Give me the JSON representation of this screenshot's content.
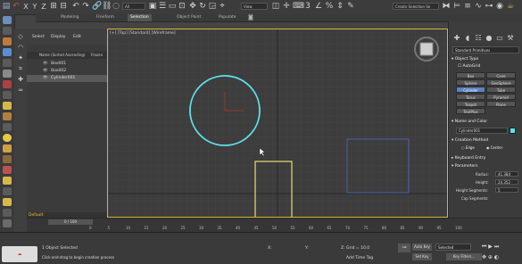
{
  "toolbar": {
    "axes": [
      "X",
      "Y",
      "Z"
    ],
    "all_filter": "All",
    "view_dropdown": "View",
    "selection_set": "Create Selection Se"
  },
  "ribbon": {
    "tabs": [
      "Modeling",
      "Freeform",
      "Selection",
      "Object Paint",
      "Populate"
    ]
  },
  "scene_explorer": {
    "menu": [
      "Select",
      "Display",
      "Edit"
    ],
    "header": "Name (Sorted Ascending)",
    "frozen_col": "Frozen",
    "items": [
      "Box001",
      "Box002",
      "Cylinder001"
    ]
  },
  "viewport": {
    "label": "[+] [Top] [Standard] [Wireframe]"
  },
  "command_panel": {
    "dropdown": "Standard Primitives",
    "object_type_title": "Object Type",
    "autogrid": "AutoGrid",
    "object_buttons": [
      "Box",
      "Cone",
      "Sphere",
      "GeoSphere",
      "Cylinder",
      "Tube",
      "Torus",
      "Pyramid",
      "Teapot",
      "Plane",
      "TextPlus"
    ],
    "name_color_title": "Name and Color",
    "object_name": "Cylinder001",
    "creation_title": "Creation Method",
    "creation_edge": "Edge",
    "creation_center": "Center",
    "keyboard_title": "Keyboard Entry",
    "params_title": "Parameters",
    "radius_label": "Radius:",
    "radius_value": "41.384",
    "height_label": "Height:",
    "height_value": "24.352",
    "hseg_label": "Height Segments:",
    "hseg_value": "5",
    "capseg_label": "Cap Segments:"
  },
  "layer": {
    "name": "Default"
  },
  "timeline": {
    "frame": "0 / 100",
    "ticks": [
      "0",
      "5",
      "10",
      "15",
      "20",
      "25",
      "30",
      "35",
      "40",
      "45",
      "50",
      "55",
      "60",
      "65",
      "70",
      "75",
      "80",
      "85",
      "90",
      "95",
      "100"
    ]
  },
  "status": {
    "selected": "1 Object Selected",
    "hint": "Click-and-drag to begin creation process",
    "grid": "Grid = 10.0",
    "add_time_tag": "Add Time Tag",
    "auto_key": "Auto Key",
    "set_key": "Set Key",
    "selected_dd": "Selected",
    "key_filters": "Key Filters..."
  },
  "colors": {
    "active_viewport_border": "#d8b23b",
    "selected_cylinder": "#5fe0e8",
    "box_yellow": "#e8e070",
    "box_blue": "#4a63a8",
    "button_active": "#5a84c4"
  }
}
